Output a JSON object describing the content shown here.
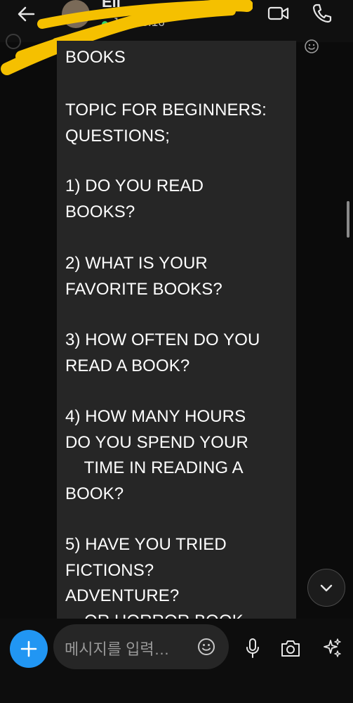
{
  "header": {
    "contact_name": "Eli",
    "status_text": "John 3:16"
  },
  "message": {
    "lines": [
      "BOOKS",
      "",
      "TOPIC FOR BEGINNERS:",
      "QUESTIONS;",
      "",
      "1) DO YOU READ",
      "BOOKS?",
      "",
      "2) WHAT IS YOUR",
      "FAVORITE BOOKS?",
      "",
      "3) HOW OFTEN DO YOU",
      "READ A BOOK?",
      "",
      "4) HOW MANY HOURS",
      "DO YOU SPEND YOUR",
      "    TIME IN READING A",
      "BOOK?",
      "",
      "5) HAVE YOU TRIED",
      "FICTIONS?",
      "ADVENTURE?",
      "    OR HORROR BOOK"
    ]
  },
  "composer": {
    "placeholder": "메시지를 입력…"
  },
  "colors": {
    "accent": "#2196f3",
    "bubble": "#262626",
    "status_online": "#2fd36a",
    "redaction": "#f5c000"
  },
  "icons": [
    "back-arrow-icon",
    "video-call-icon",
    "phone-icon",
    "smiley-icon",
    "chevron-down-icon",
    "plus-icon",
    "microphone-icon",
    "camera-icon",
    "sparkle-icon"
  ]
}
